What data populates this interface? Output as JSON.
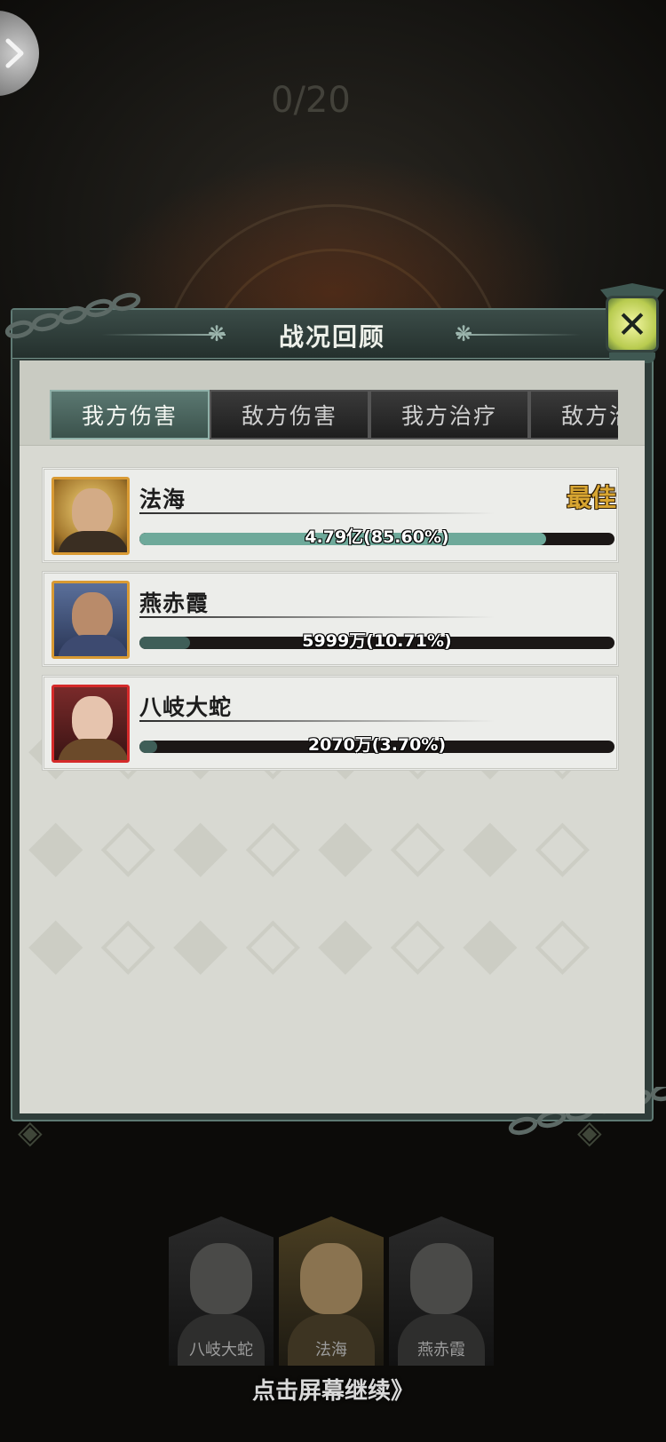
{
  "background": {
    "counter_text": "0/20"
  },
  "panel": {
    "title": "战况回顾",
    "close_symbol": "✕",
    "tabs": [
      {
        "label": "我方伤害",
        "active": true
      },
      {
        "label": "敌方伤害",
        "active": false
      },
      {
        "label": "我方治疗",
        "active": false
      },
      {
        "label": "敌方治疗",
        "active": false
      }
    ],
    "rows": [
      {
        "name": "法海",
        "value_text": "4.79亿(85.60%)",
        "percent": 85.6,
        "best_label": "最佳",
        "bar_color": "#6ea99a",
        "avatar_frame": "gold"
      },
      {
        "name": "燕赤霞",
        "value_text": "5999万(10.71%)",
        "percent": 10.71,
        "bar_color": "#3f5e58",
        "avatar_frame": "gold"
      },
      {
        "name": "八岐大蛇",
        "value_text": "2070万(3.70%)",
        "percent": 3.7,
        "bar_color": "#3f5e58",
        "avatar_frame": "red"
      }
    ]
  },
  "bottom": {
    "heroes": [
      {
        "name": "八岐大蛇"
      },
      {
        "name": "法海"
      },
      {
        "name": "燕赤霞"
      }
    ],
    "continue_hint": "点击屏幕继续》"
  },
  "colors": {
    "panel_frame": "#2f3d3a",
    "active_tab": "#4b665f",
    "best_gold": "#d8a531",
    "bar_top": "#6ea99a",
    "bar_other": "#3f5e58"
  },
  "icons": {
    "back": "chevron-right-icon",
    "close": "close-icon"
  }
}
